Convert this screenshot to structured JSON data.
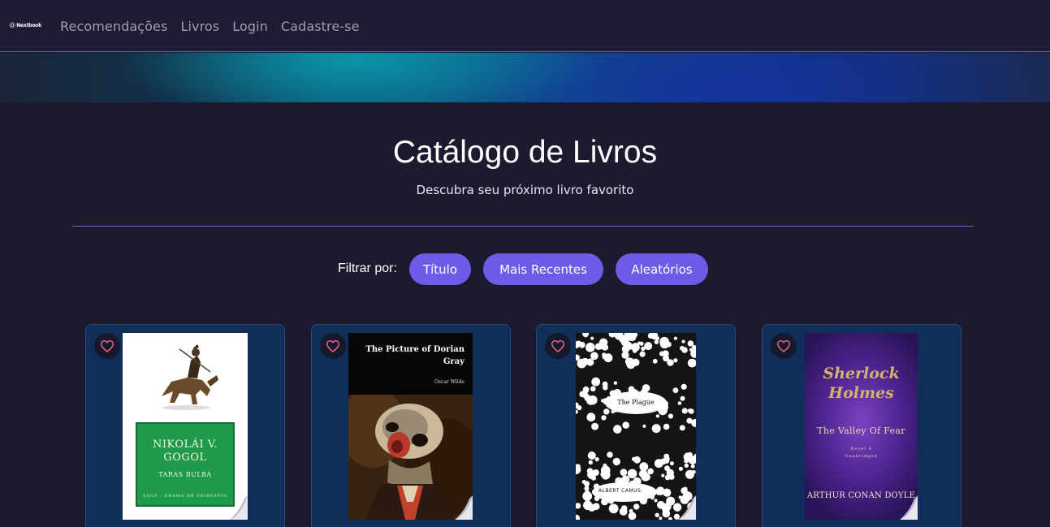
{
  "nav": {
    "logo_text": "Nextbook",
    "links": [
      "Recomendações",
      "Livros",
      "Login",
      "Cadastre-se"
    ]
  },
  "header": {
    "title": "Catálogo de Livros",
    "subtitle": "Descubra seu próximo livro favorito"
  },
  "filter": {
    "label": "Filtrar por:",
    "options": [
      "Título",
      "Mais Recentes",
      "Aleatórios"
    ]
  },
  "books": [
    {
      "cover_lines": [
        "NIKOLÁI V.",
        "GOGOL",
        "TARAS BULBA",
        "SAGA - DRAMA DE PRINCIPIO"
      ],
      "favorite_icon": "heart-outline-icon"
    },
    {
      "cover_lines": [
        "The Picture of Dorian Gray",
        "Oscar Wilde"
      ],
      "favorite_icon": "heart-outline-icon"
    },
    {
      "cover_lines": [
        "The Plague",
        "ALBERT CAMUS"
      ],
      "favorite_icon": "heart-outline-icon"
    },
    {
      "cover_lines": [
        "Sherlock Holmes",
        "The Valley Of Fear",
        "Novel 4",
        "Unabridged",
        "ARTHUR CONAN DOYLE"
      ],
      "favorite_icon": "heart-outline-icon"
    }
  ],
  "colors": {
    "background": "#1c1a2e",
    "accent": "#6c5ce7",
    "card": "#0f2f5a",
    "heart": "#f06292"
  }
}
